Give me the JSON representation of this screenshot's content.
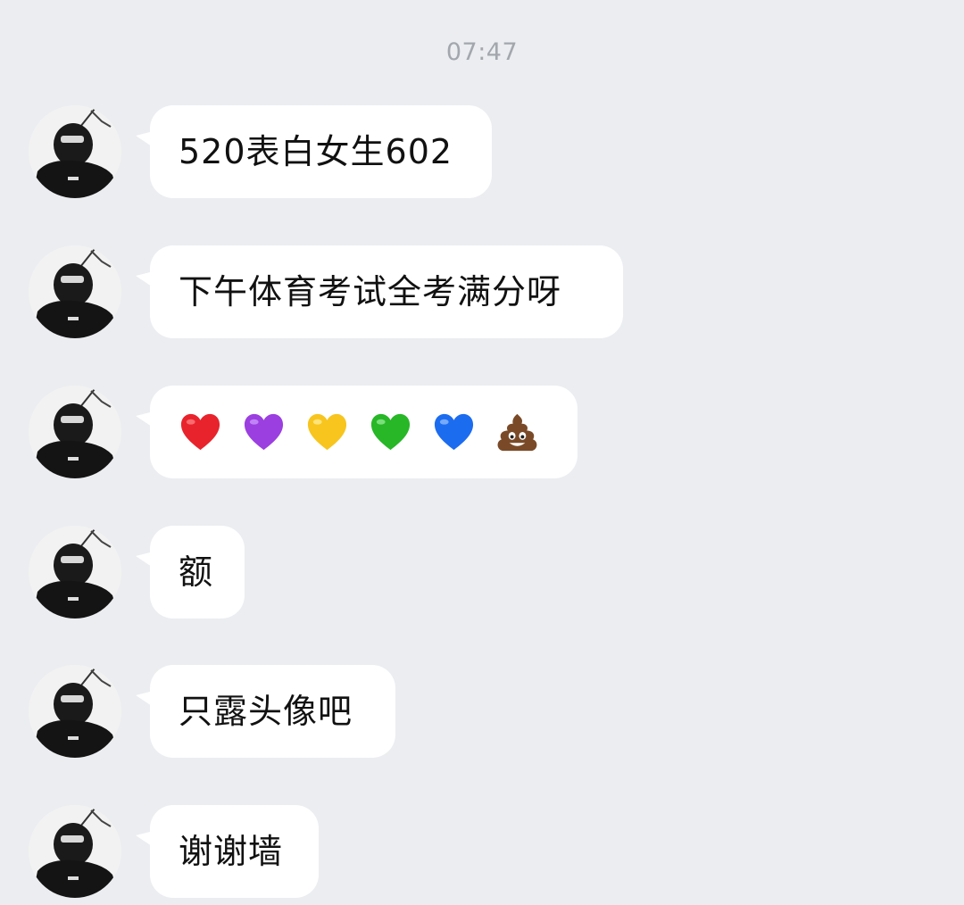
{
  "chat": {
    "timestamp": "07:47",
    "messages": [
      {
        "text": "520表白女生602"
      },
      {
        "text": "下午体育考试全考满分呀"
      },
      {
        "emojis": [
          {
            "name": "red-heart-icon",
            "color": "#e8232c"
          },
          {
            "name": "purple-heart-icon",
            "color": "#9b3fe0"
          },
          {
            "name": "yellow-heart-icon",
            "color": "#f7c51e"
          },
          {
            "name": "green-heart-icon",
            "color": "#27b727"
          },
          {
            "name": "blue-heart-icon",
            "color": "#1c6cf0"
          },
          {
            "name": "pile-of-poo-icon",
            "color": "#7a4a28"
          }
        ]
      },
      {
        "text": "额"
      },
      {
        "text": "只露头像吧"
      },
      {
        "text": "谢谢墙"
      }
    ]
  }
}
